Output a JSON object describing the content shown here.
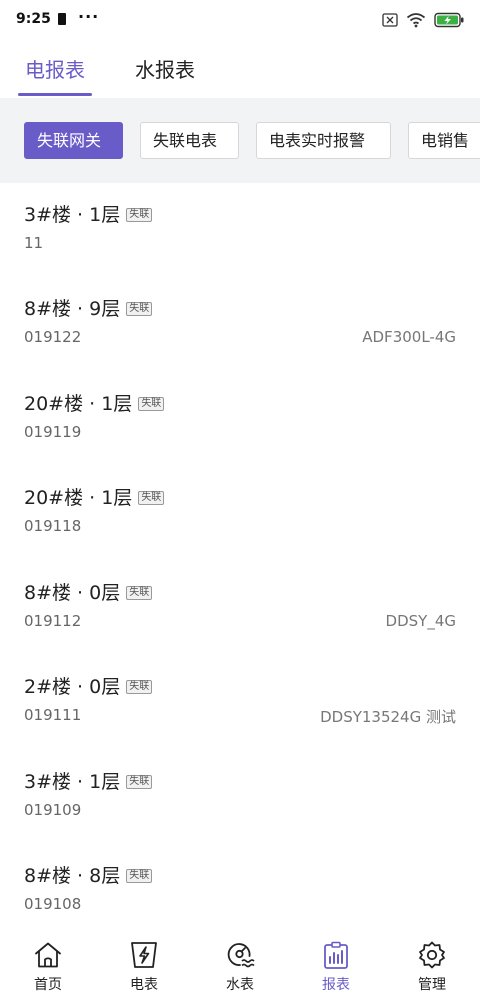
{
  "status_bar": {
    "time": "9:25",
    "icons": [
      "sim-card-icon",
      "more-dots-icon",
      "no-sim-icon",
      "wifi-icon",
      "battery-charging-icon"
    ],
    "dots": "···"
  },
  "top_tabs": [
    {
      "label": "电报表",
      "active": true
    },
    {
      "label": "水报表",
      "active": false
    }
  ],
  "filters": [
    {
      "label": "失联网关",
      "active": true
    },
    {
      "label": "失联电表",
      "active": false
    },
    {
      "label": "电表实时报警",
      "active": false
    },
    {
      "label": "电销售",
      "active": false
    }
  ],
  "devices": [
    {
      "title": "3#楼 · 1层",
      "badge": "失联",
      "code": "11",
      "model": ""
    },
    {
      "title": "8#楼 · 9层",
      "badge": "失联",
      "code": "019122",
      "model": "ADF300L-4G"
    },
    {
      "title": "20#楼 · 1层",
      "badge": "失联",
      "code": "019119",
      "model": ""
    },
    {
      "title": "20#楼 · 1层",
      "badge": "失联",
      "code": "019118",
      "model": ""
    },
    {
      "title": "8#楼 · 0层",
      "badge": "失联",
      "code": "019112",
      "model": "DDSY_4G"
    },
    {
      "title": "2#楼 · 0层",
      "badge": "失联",
      "code": "019111",
      "model": "DDSY13524G 测试"
    },
    {
      "title": "3#楼 · 1层",
      "badge": "失联",
      "code": "019109",
      "model": ""
    },
    {
      "title": "8#楼 · 8层",
      "badge": "失联",
      "code": "019108",
      "model": ""
    }
  ],
  "bottom_nav": [
    {
      "label": "首页",
      "icon": "home-icon",
      "active": false
    },
    {
      "label": "电表",
      "icon": "electric-meter-icon",
      "active": false
    },
    {
      "label": "水表",
      "icon": "water-meter-icon",
      "active": false
    },
    {
      "label": "报表",
      "icon": "report-icon",
      "active": true
    },
    {
      "label": "管理",
      "icon": "settings-gear-icon",
      "active": false
    }
  ],
  "colors": {
    "accent": "#6a5cc8",
    "filter_bg": "#f2f3f5",
    "battery_green": "#3cb043"
  }
}
